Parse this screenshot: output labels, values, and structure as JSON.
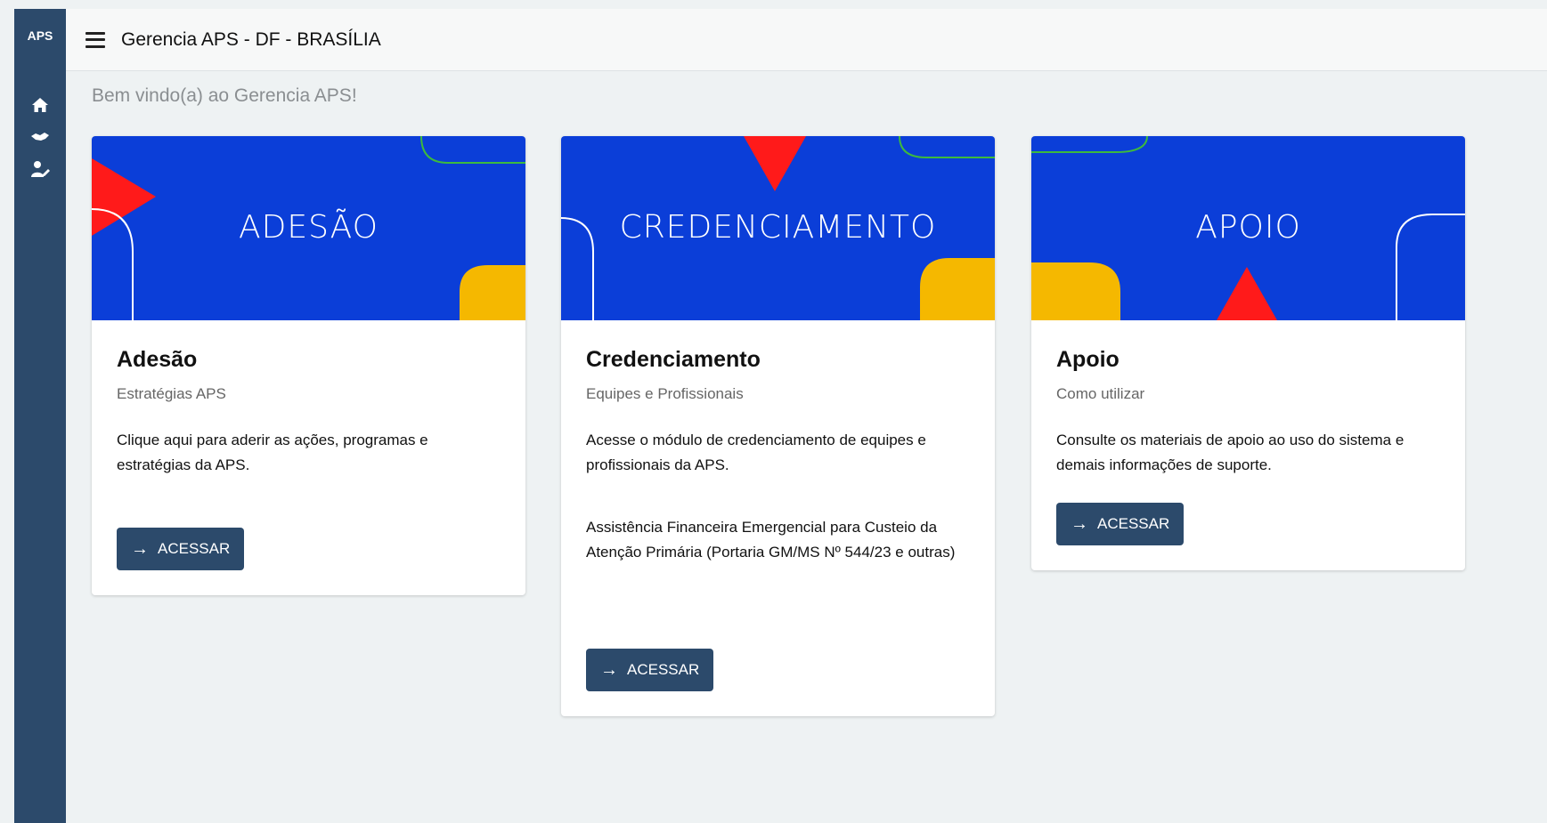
{
  "sidebar": {
    "brand": "APS",
    "items": [
      {
        "icon": "home-icon"
      },
      {
        "icon": "handshake-icon"
      },
      {
        "icon": "user-edit-icon"
      }
    ]
  },
  "header": {
    "title": "Gerencia APS -  DF - BRASÍLIA"
  },
  "main": {
    "welcome": "Bem vindo(a) ao Gerencia APS!",
    "cards": [
      {
        "banner_label": "ADESÃO",
        "title": "Adesão",
        "subtitle": "Estratégias APS",
        "description": "Clique aqui para aderir as ações, programas e estratégias da APS.",
        "button_label": "ACESSAR"
      },
      {
        "banner_label": "CREDENCIAMENTO",
        "title": "Credenciamento",
        "subtitle": "Equipes e Profissionais",
        "description": "Acesse o módulo de credenciamento de equipes e profissionais da APS.",
        "description2": "Assistência Financeira Emergencial para Custeio da Atenção Primária (Portaria GM/MS Nº 544/23 e outras)",
        "button_label": "ACESSAR"
      },
      {
        "banner_label": "APOIO",
        "title": "Apoio",
        "subtitle": "Como utilizar",
        "description": "Consulte os materiais de apoio ao uso do sistema e demais informações de suporte.",
        "button_label": "ACESSAR"
      }
    ]
  },
  "colors": {
    "sidebar": "#2c4a6b",
    "banner_blue": "#0b3ed8",
    "accent_red": "#ff1a1a",
    "accent_yellow": "#f5b800",
    "accent_green": "#3dba3d",
    "button": "#2c4a6b"
  }
}
